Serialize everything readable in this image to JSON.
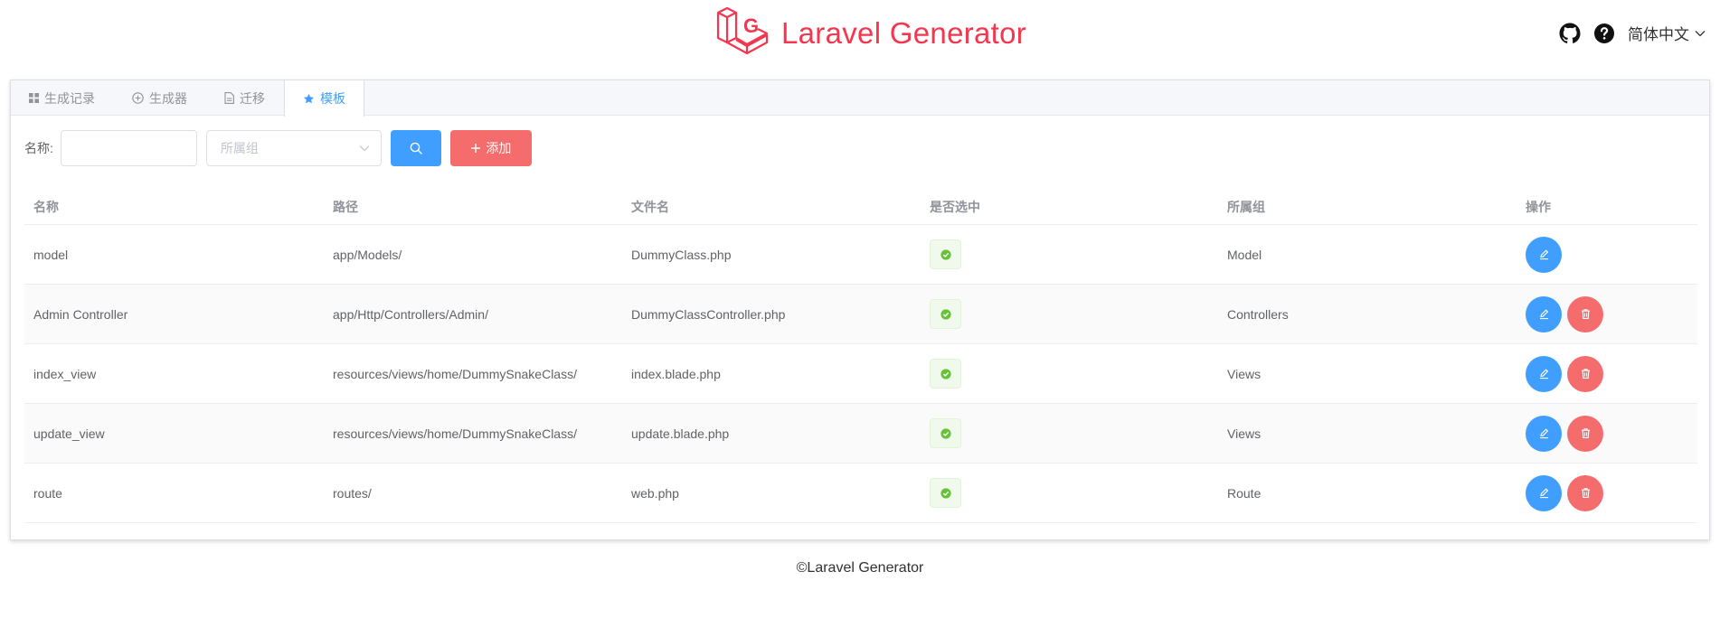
{
  "header": {
    "title": "Laravel Generator",
    "logo_letter": "G",
    "brand_color": "#f4374e",
    "language": "简体中文"
  },
  "tabs": [
    {
      "label": "生成记录",
      "icon": "grid-icon"
    },
    {
      "label": "生成器",
      "icon": "plus-circle-icon"
    },
    {
      "label": "迁移",
      "icon": "document-icon"
    },
    {
      "label": "模板",
      "icon": "star-icon",
      "active": true
    }
  ],
  "filter": {
    "name_label": "名称:",
    "name_value": "",
    "group_placeholder": "所属组",
    "add_label": "添加"
  },
  "table": {
    "headers": [
      "名称",
      "路径",
      "文件名",
      "是否选中",
      "所属组",
      "操作"
    ],
    "rows": [
      {
        "name": "model",
        "path": "app/Models/",
        "file": "DummyClass.php",
        "selected": true,
        "group": "Model",
        "deletable": false
      },
      {
        "name": "Admin Controller",
        "path": "app/Http/Controllers/Admin/",
        "file": "DummyClassController.php",
        "selected": true,
        "group": "Controllers",
        "deletable": true
      },
      {
        "name": "index_view",
        "path": "resources/views/home/DummySnakeClass/",
        "file": "index.blade.php",
        "selected": true,
        "group": "Views",
        "deletable": true
      },
      {
        "name": "update_view",
        "path": "resources/views/home/DummySnakeClass/",
        "file": "update.blade.php",
        "selected": true,
        "group": "Views",
        "deletable": true
      },
      {
        "name": "route",
        "path": "routes/",
        "file": "web.php",
        "selected": true,
        "group": "Route",
        "deletable": true
      }
    ]
  },
  "footer": {
    "text": "©Laravel Generator"
  },
  "colors": {
    "primary": "#409eff",
    "danger": "#f56c6c",
    "success": "#67c23a"
  }
}
